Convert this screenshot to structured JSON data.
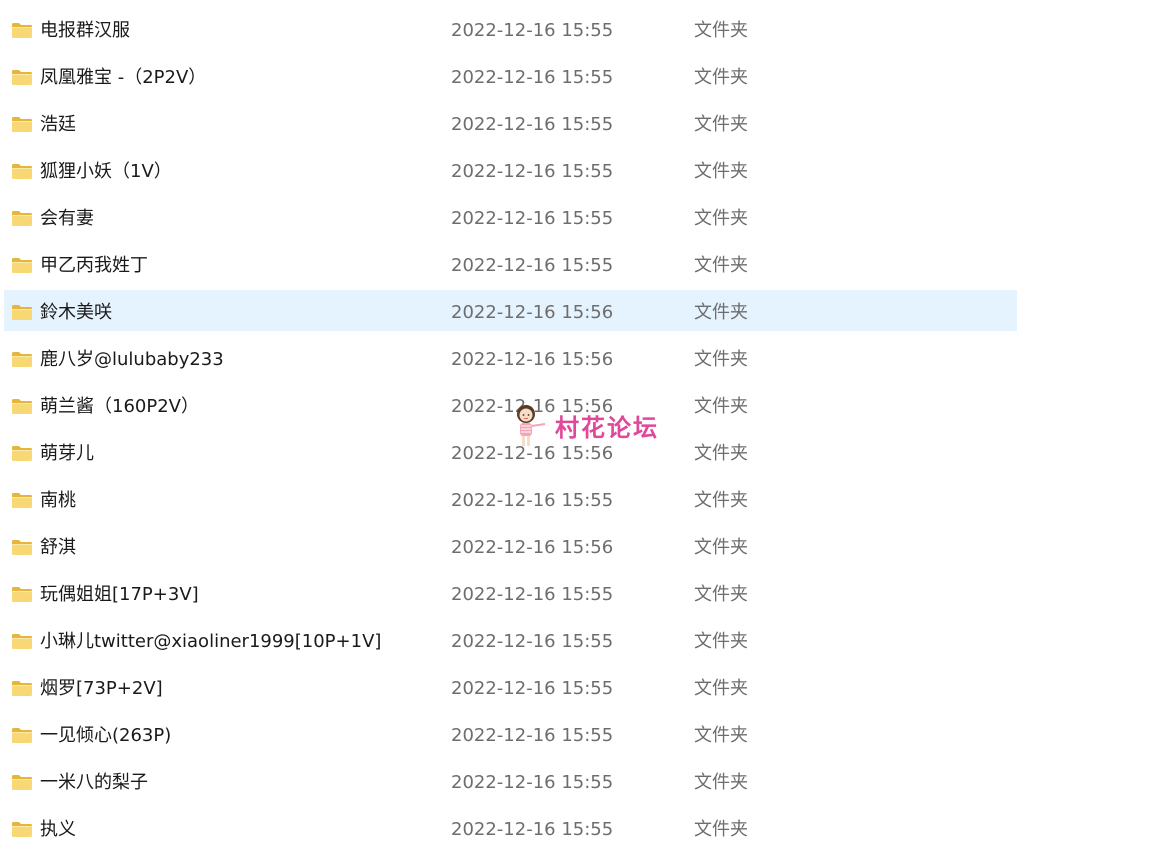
{
  "files": [
    {
      "name": "电报群汉服",
      "date": "2022-12-16 15:55",
      "type": "文件夹",
      "icon": "folder-icon",
      "selected": false
    },
    {
      "name": "凤凰雅宝 -（2P2V）",
      "date": "2022-12-16 15:55",
      "type": "文件夹",
      "icon": "folder-icon",
      "selected": false
    },
    {
      "name": "浩廷",
      "date": "2022-12-16 15:55",
      "type": "文件夹",
      "icon": "folder-icon",
      "selected": false
    },
    {
      "name": "狐狸小妖（1V）",
      "date": "2022-12-16 15:55",
      "type": "文件夹",
      "icon": "folder-icon",
      "selected": false
    },
    {
      "name": "会有妻",
      "date": "2022-12-16 15:55",
      "type": "文件夹",
      "icon": "folder-icon",
      "selected": false
    },
    {
      "name": "甲乙丙我姓丁",
      "date": "2022-12-16 15:55",
      "type": "文件夹",
      "icon": "folder-icon",
      "selected": false
    },
    {
      "name": "鈴木美咲",
      "date": "2022-12-16 15:56",
      "type": "文件夹",
      "icon": "folder-icon",
      "selected": true
    },
    {
      "name": "鹿八岁@lulubaby233",
      "date": "2022-12-16 15:56",
      "type": "文件夹",
      "icon": "folder-icon",
      "selected": false
    },
    {
      "name": "萌兰酱（160P2V）",
      "date": "2022-12-16 15:56",
      "type": "文件夹",
      "icon": "folder-icon",
      "selected": false
    },
    {
      "name": "萌芽儿",
      "date": "2022-12-16 15:56",
      "type": "文件夹",
      "icon": "folder-icon",
      "selected": false
    },
    {
      "name": "南桃",
      "date": "2022-12-16 15:55",
      "type": "文件夹",
      "icon": "folder-icon",
      "selected": false
    },
    {
      "name": "舒淇",
      "date": "2022-12-16 15:56",
      "type": "文件夹",
      "icon": "folder-icon",
      "selected": false
    },
    {
      "name": "玩偶姐姐[17P+3V]",
      "date": "2022-12-16 15:55",
      "type": "文件夹",
      "icon": "folder-icon",
      "selected": false
    },
    {
      "name": "小琳儿twitter@xiaoliner1999[10P+1V]",
      "date": "2022-12-16 15:55",
      "type": "文件夹",
      "icon": "folder-icon",
      "selected": false
    },
    {
      "name": "烟罗[73P+2V]",
      "date": "2022-12-16 15:55",
      "type": "文件夹",
      "icon": "folder-icon",
      "selected": false
    },
    {
      "name": "一见倾心(263P)",
      "date": "2022-12-16 15:55",
      "type": "文件夹",
      "icon": "folder-icon",
      "selected": false
    },
    {
      "name": "一米八的梨子",
      "date": "2022-12-16 15:55",
      "type": "文件夹",
      "icon": "folder-icon",
      "selected": false
    },
    {
      "name": "执义",
      "date": "2022-12-16 15:55",
      "type": "文件夹",
      "icon": "folder-icon",
      "selected": false
    }
  ],
  "watermark": {
    "text": "村花论坛",
    "color": "#e0489a",
    "icon": "cartoon-girl-icon"
  },
  "colors": {
    "selected_row": "#e5f3ff",
    "folder_body": "#f8d775",
    "folder_tab": "#e8b53c",
    "secondary_text": "#6d6d6d"
  }
}
